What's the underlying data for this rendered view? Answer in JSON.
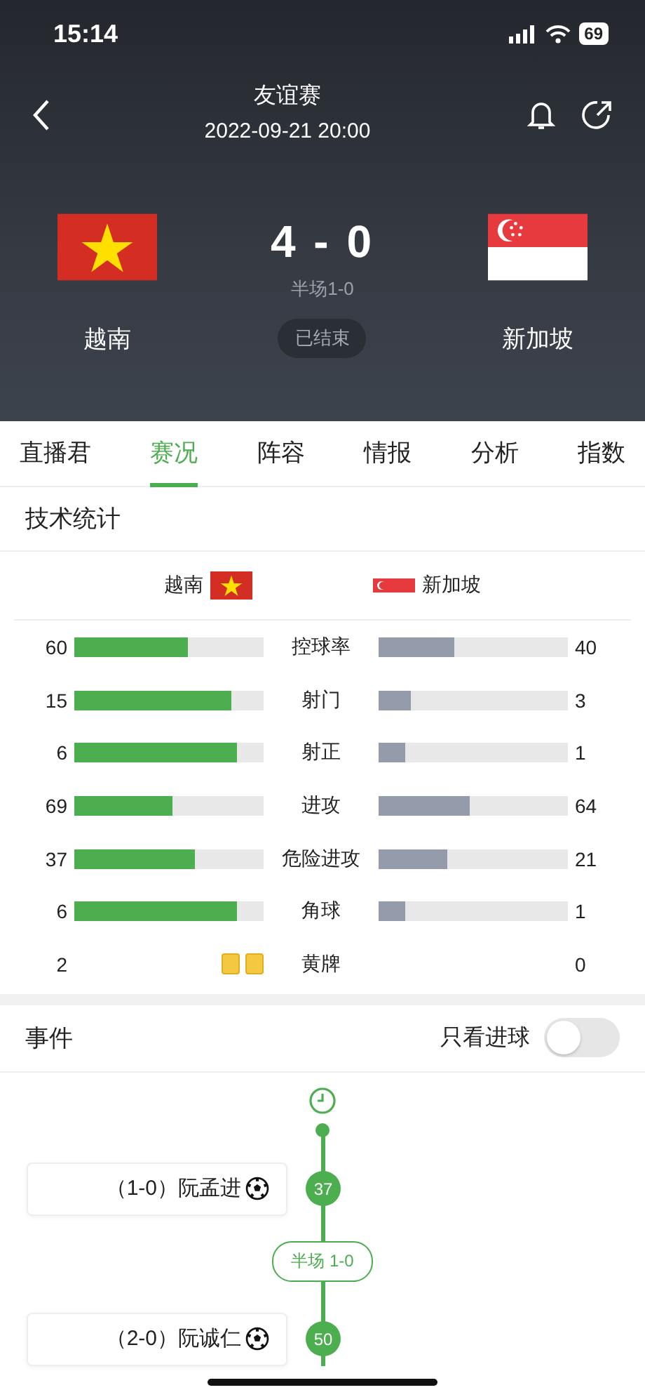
{
  "status_bar": {
    "time": "15:14",
    "battery": "69"
  },
  "header": {
    "competition": "友谊赛",
    "datetime": "2022-09-21 20:00",
    "home": {
      "name": "越南",
      "flag": {
        "kind": "vietnam"
      }
    },
    "away": {
      "name": "新加坡",
      "flag": {
        "kind": "singapore"
      }
    },
    "score": "4 - 0",
    "halftime": "半场1-0",
    "status": "已结束"
  },
  "tabs": [
    {
      "label": "直播君",
      "selected": false
    },
    {
      "label": "赛况",
      "selected": true
    },
    {
      "label": "阵容",
      "selected": false
    },
    {
      "label": "情报",
      "selected": false
    },
    {
      "label": "分析",
      "selected": false
    },
    {
      "label": "指数",
      "selected": false
    }
  ],
  "stats": {
    "title": "技术统计",
    "home_team": {
      "name": "越南",
      "flag": {
        "kind": "vietnam"
      }
    },
    "away_team": {
      "name": "新加坡",
      "flag": {
        "kind": "singapore"
      }
    },
    "rows": [
      {
        "kind": "bar",
        "label": "控球率",
        "home": {
          "value": "60",
          "level": 0.6
        },
        "away": {
          "value": "40",
          "level": 0.4
        }
      },
      {
        "kind": "bar",
        "label": "射门",
        "home": {
          "value": "15",
          "level": 0.833
        },
        "away": {
          "value": "3",
          "level": 0.167
        }
      },
      {
        "kind": "bar",
        "label": "射正",
        "home": {
          "value": "6",
          "level": 0.857
        },
        "away": {
          "value": "1",
          "level": 0.143
        }
      },
      {
        "kind": "bar",
        "label": "进攻",
        "home": {
          "value": "69",
          "level": 0.519
        },
        "away": {
          "value": "64",
          "level": 0.481
        }
      },
      {
        "kind": "bar",
        "label": "危险进攻",
        "home": {
          "value": "37",
          "level": 0.638
        },
        "away": {
          "value": "21",
          "level": 0.362
        }
      },
      {
        "kind": "bar",
        "label": "角球",
        "home": {
          "value": "6",
          "level": 0.857
        },
        "away": {
          "value": "1",
          "level": 0.143
        }
      },
      {
        "kind": "cards",
        "label": "黄牌",
        "home": {
          "value": "2",
          "cards": [
            {
              "kind": "yellow"
            },
            {
              "kind": "yellow"
            }
          ]
        },
        "away": {
          "value": "0"
        }
      }
    ]
  },
  "events": {
    "title": "事件",
    "filter": {
      "label": "只看进球",
      "on": false
    },
    "timeline": [
      {
        "kind": "goal",
        "minute": "37",
        "text": "（1-0）阮孟进"
      },
      {
        "kind": "period",
        "text": "半场 1-0"
      },
      {
        "kind": "goal",
        "minute": "50",
        "text": "（2-0）阮诚仁"
      }
    ]
  }
}
